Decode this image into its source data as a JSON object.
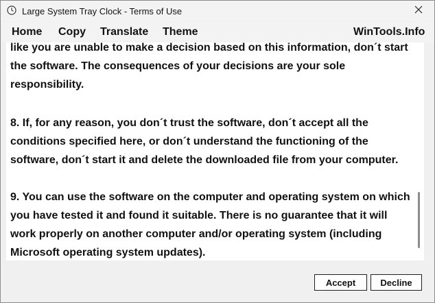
{
  "window": {
    "title": "Large System Tray Clock - Terms of Use",
    "app_icon": "clock-icon",
    "close_icon": "close-icon"
  },
  "menu": {
    "home": "Home",
    "copy": "Copy",
    "translate": "Translate",
    "theme": "Theme",
    "site": "WinTools.Info"
  },
  "content": {
    "paragraphs": [
      "like you are unable to make a decision based on this information, don´t start the software. The consequences of your decisions are your sole responsibility.",
      "8. If, for any reason, you don´t trust the software, don´t accept all the conditions specified here, or don´t understand the functioning of the software, don´t start it and delete the downloaded file from your computer.",
      "9. You can use the software on the computer and operating system on which you have tested it and found it suitable. There is no guarantee that it will work properly on another computer and/or operating system (including Microsoft operating system updates)."
    ]
  },
  "buttons": {
    "accept": "Accept",
    "decline": "Decline"
  },
  "colors": {
    "window_bg": "#f0f0f0",
    "content_bg": "#ffffff",
    "text": "#111111",
    "button_border": "#1f1f1f"
  }
}
